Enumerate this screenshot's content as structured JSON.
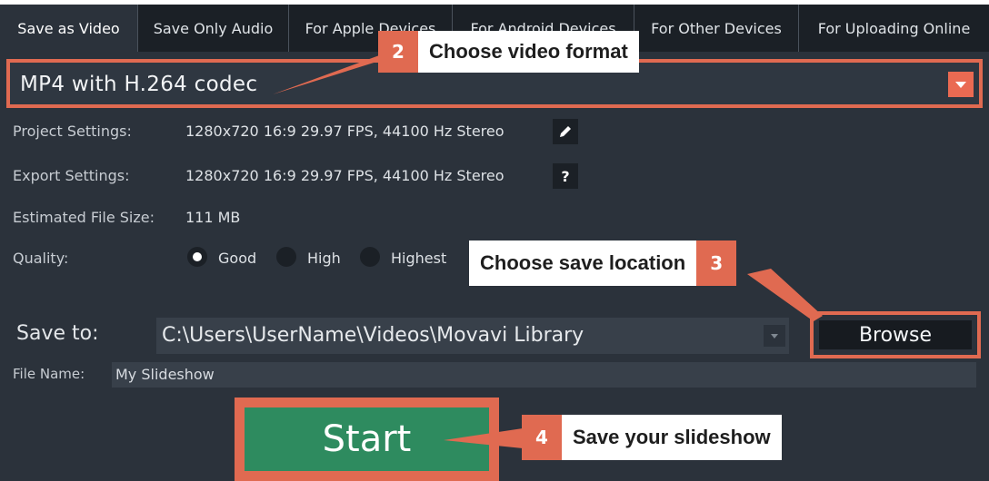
{
  "tabs": [
    {
      "label": "Save as Video",
      "active": true
    },
    {
      "label": "Save Only Audio",
      "active": false
    },
    {
      "label": "For Apple Devices",
      "active": false
    },
    {
      "label": "For Android Devices",
      "active": false
    },
    {
      "label": "For Other Devices",
      "active": false
    },
    {
      "label": "For Uploading Online",
      "active": false
    }
  ],
  "format": {
    "selected": "MP4 with H.264 codec"
  },
  "project_settings": {
    "label": "Project Settings:",
    "value": "1280x720 16:9 29.97 FPS, 44100 Hz Stereo"
  },
  "export_settings": {
    "label": "Export Settings:",
    "value": "1280x720 16:9 29.97 FPS, 44100 Hz Stereo",
    "help": "?"
  },
  "file_size": {
    "label": "Estimated File Size:",
    "value": "111 MB"
  },
  "quality": {
    "label": "Quality:",
    "options": [
      "Good",
      "High",
      "Highest"
    ],
    "selected": "Good"
  },
  "save_to": {
    "label": "Save to:",
    "path": "C:\\Users\\UserName\\Videos\\Movavi Library",
    "browse": "Browse"
  },
  "file_name": {
    "label": "File Name:",
    "value": "My Slideshow"
  },
  "start_label": "Start",
  "callouts": [
    {
      "num": "2",
      "text": "Choose video format"
    },
    {
      "num": "3",
      "text": "Choose save location"
    },
    {
      "num": "4",
      "text": "Save your slideshow"
    }
  ],
  "colors": {
    "accent": "#e06a51",
    "start_green": "#2e8b5f",
    "panel": "#2b323b",
    "tabbar": "#1b2026"
  }
}
